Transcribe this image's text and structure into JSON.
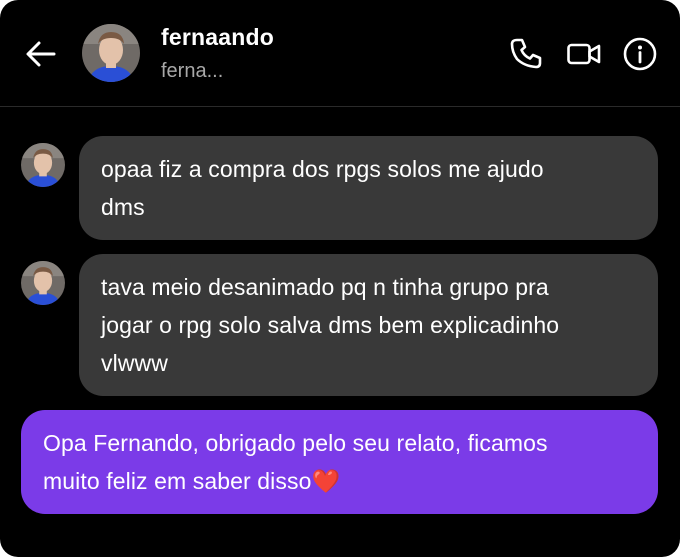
{
  "header": {
    "name": "fernaando",
    "username": "ferna...",
    "back_icon": "arrow-left-icon",
    "call_icon": "phone-icon",
    "video_icon": "video-camera-icon",
    "info_icon": "info-icon"
  },
  "messages": [
    {
      "sender": "fernaando",
      "direction": "incoming",
      "lines": [
        "opaa fiz a compra dos rpgs solos me ajudo",
        "dms"
      ]
    },
    {
      "sender": "fernaando",
      "direction": "incoming",
      "lines": [
        "tava meio desanimado pq n tinha grupo pra",
        "jogar o rpg solo salva dms bem explicadinho",
        "vlwww"
      ]
    },
    {
      "sender": "me",
      "direction": "outgoing",
      "lines": [
        "Opa Fernando, obrigado pelo seu relato, ficamos",
        "muito feliz em saber disso❤️"
      ]
    }
  ],
  "colors": {
    "background": "#000000",
    "incoming_bubble": "#393939",
    "outgoing_bubble": "#7b3be8",
    "secondary_text": "#a8a8a8"
  }
}
